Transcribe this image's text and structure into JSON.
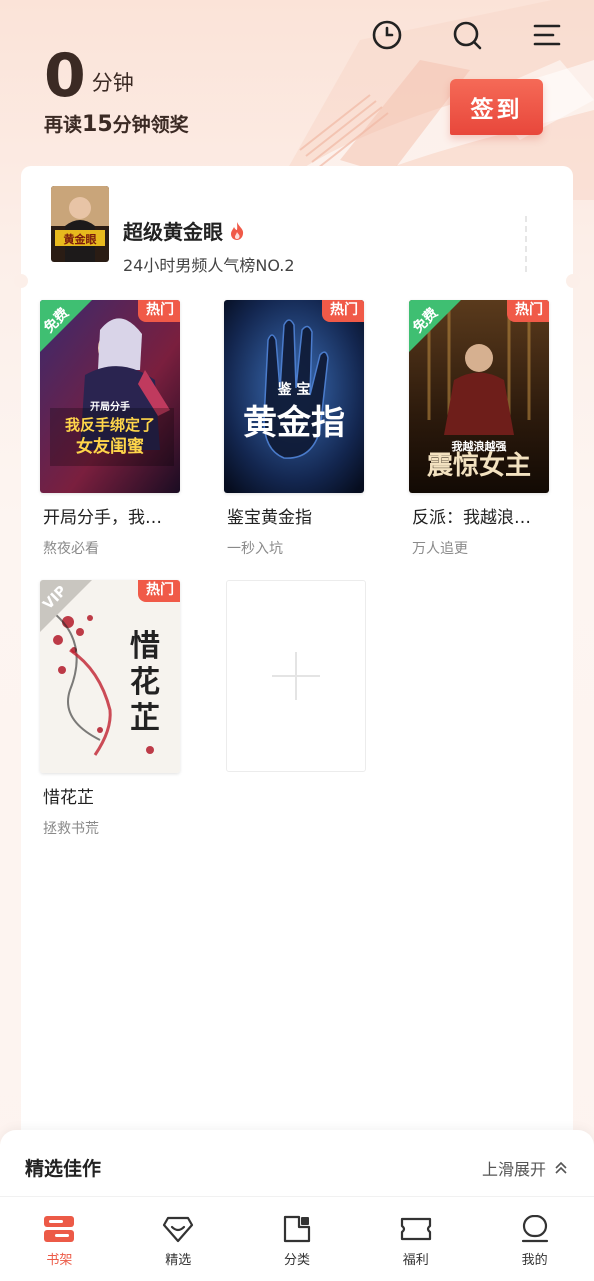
{
  "header": {
    "icons": [
      "history-icon",
      "search-icon",
      "menu-icon"
    ],
    "reading_minutes": "0",
    "minutes_unit": "分钟",
    "reward_tip_prefix": "再读",
    "reward_tip_minutes": "15",
    "reward_tip_suffix": "分钟领奖",
    "checkin_label": "签到"
  },
  "rank_card": {
    "title": "超级黄金眼",
    "subtitle": "24小时男频人气榜NO.2",
    "cover_text": "黄金眼"
  },
  "books": [
    {
      "title": "开局分手，我…",
      "tag": "熬夜必看",
      "hot": "热门",
      "corner": "免费",
      "cover_text": "开局分手 我反手绑定了女友闺蜜"
    },
    {
      "title": "鉴宝黄金指",
      "tag": "一秒入坑",
      "hot": "热门",
      "corner": "",
      "cover_text": "黄金指"
    },
    {
      "title": "反派：我越浪…",
      "tag": "万人追更",
      "hot": "热门",
      "corner": "免费",
      "cover_text": "震惊女主"
    },
    {
      "title": "惜花芷",
      "tag": "拯救书荒",
      "hot": "热门",
      "corner": "VIP",
      "cover_text": "惜花芷"
    }
  ],
  "featured": {
    "title": "精选佳作",
    "expand_label": "上滑展开"
  },
  "tabs": [
    {
      "label": "书架",
      "icon": "bookshelf-icon",
      "active": true
    },
    {
      "label": "精选",
      "icon": "diamond-icon",
      "active": false
    },
    {
      "label": "分类",
      "icon": "category-icon",
      "active": false
    },
    {
      "label": "福利",
      "icon": "ticket-icon",
      "active": false
    },
    {
      "label": "我的",
      "icon": "profile-icon",
      "active": false
    }
  ],
  "colors": {
    "accent": "#ec5a47",
    "badge_free": "#3fbf72",
    "badge_hot": "#f05a48"
  }
}
